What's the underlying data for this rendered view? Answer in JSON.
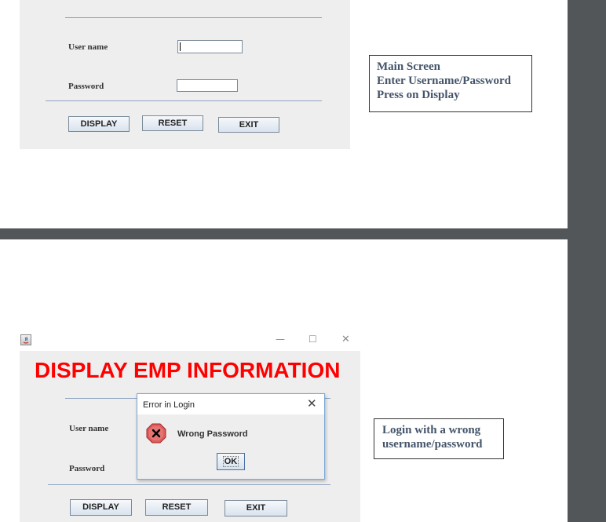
{
  "screen1": {
    "form": {
      "username_label": "User name",
      "password_label": "Password",
      "username_value": "",
      "password_value": ""
    },
    "buttons": {
      "display": "DISPLAY",
      "reset": "RESET",
      "exit": "EXIT"
    },
    "note": [
      "Main Screen",
      "Enter Username/Password",
      "Press on Display"
    ]
  },
  "screen2": {
    "window": {
      "minimize": "—",
      "maximize": "☐",
      "close": "✕"
    },
    "title": "DISPLAY EMP INFORMATION",
    "form": {
      "username_label": "User name",
      "password_label": "Password"
    },
    "dialog": {
      "title": "Error in Login",
      "close": "✕",
      "message": "Wrong Password",
      "ok": "OK"
    },
    "buttons": {
      "display": "DISPLAY",
      "reset": "RESET",
      "exit": "EXIT"
    },
    "note": [
      "Login with a wrong",
      "username/password"
    ]
  },
  "colors": {
    "title_red": "#ff0000",
    "note_text": "#44546a",
    "panel_bg": "#eeeeee",
    "viewer_bg": "#525659"
  }
}
